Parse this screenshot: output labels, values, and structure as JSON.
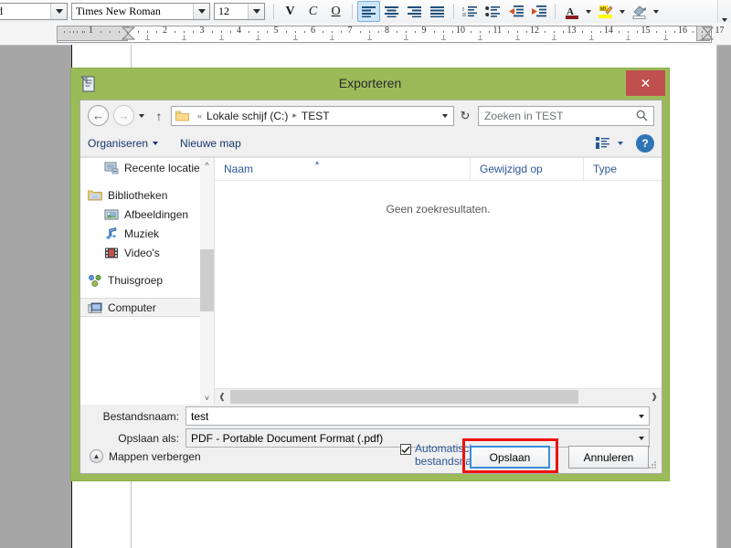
{
  "app": {
    "toolbar": {
      "style_combo_value": "d",
      "font_combo_value": "Times New Roman",
      "size_combo_value": "12",
      "bold_label": "V",
      "italic_label": "C",
      "underline_label": "O",
      "icons": [
        "align-left-icon",
        "align-center-icon",
        "align-right-icon",
        "justify-icon",
        "numbered-list-icon",
        "bulleted-list-icon",
        "decrease-indent-icon",
        "increase-indent-icon",
        "font-color-icon",
        "highlight-color-icon",
        "paragraph-shading-icon"
      ]
    },
    "ruler": {
      "labels": [
        "1",
        "1",
        "2",
        "3",
        "4",
        "5",
        "6",
        "7",
        "8",
        "9",
        "10",
        "11",
        "12",
        "13",
        "14",
        "15",
        "16",
        "17"
      ]
    }
  },
  "dialog": {
    "title": "Exporteren",
    "title_icon": "export-document-icon",
    "close_label": "✕",
    "nav": {
      "back_icon": "back-arrow-icon",
      "forward_icon": "forward-arrow-icon",
      "recent_icon": "chevron-down-icon",
      "up_icon": "up-arrow-icon",
      "breadcrumb_prefix": "«",
      "breadcrumb": [
        "Lokale schijf (C:)",
        "TEST"
      ],
      "breadcrumb_sep": "▸",
      "refresh_icon": "refresh-icon",
      "search_placeholder": "Zoeken in TEST",
      "search_icon": "search-icon"
    },
    "commandbar": {
      "organize": "Organiseren",
      "new_folder": "Nieuwe map",
      "view_icon": "view-list-icon",
      "help_label": "?"
    },
    "navpane": {
      "items": [
        {
          "label": "Recente locaties",
          "icon": "recent-locations-icon",
          "level": 2,
          "selected": false
        },
        {
          "label": "",
          "icon": "",
          "level": 1,
          "selected": false
        },
        {
          "label": "Bibliotheken",
          "icon": "libraries-icon",
          "level": 1,
          "selected": false
        },
        {
          "label": "Afbeeldingen",
          "icon": "pictures-icon",
          "level": 2,
          "selected": false
        },
        {
          "label": "Muziek",
          "icon": "music-icon",
          "level": 2,
          "selected": false
        },
        {
          "label": "Video's",
          "icon": "videos-icon",
          "level": 2,
          "selected": false
        },
        {
          "label": "",
          "icon": "",
          "level": 1,
          "selected": false
        },
        {
          "label": "Thuisgroep",
          "icon": "homegroup-icon",
          "level": 1,
          "selected": false
        },
        {
          "label": "",
          "icon": "",
          "level": 1,
          "selected": false
        },
        {
          "label": "Computer",
          "icon": "computer-icon",
          "level": 1,
          "selected": true
        }
      ]
    },
    "filepane": {
      "columns": [
        "Naam",
        "Gewijzigd op",
        "Type"
      ],
      "sort_indicator": "▴",
      "empty_message": "Geen zoekresultaten."
    },
    "fields": {
      "filename_label": "Bestandsnaam:",
      "filename_value": "test",
      "saveas_label": "Opslaan als:",
      "saveas_value": "PDF - Portable Document Format (.pdf)"
    },
    "footer": {
      "hide_folders": "Mappen verbergen",
      "autoext_line1": "Automatische",
      "autoext_line2": "bestandsnaamextensie",
      "autoext_checked": true,
      "save_button": "Opslaan",
      "cancel_button": "Annuleren"
    }
  },
  "colors": {
    "title_bar": "#9bbb59",
    "close_button": "#c0504d",
    "link_blue": "#2b5797",
    "highlight_red": "#ee1111",
    "focus_blue": "#3a8ddb"
  }
}
